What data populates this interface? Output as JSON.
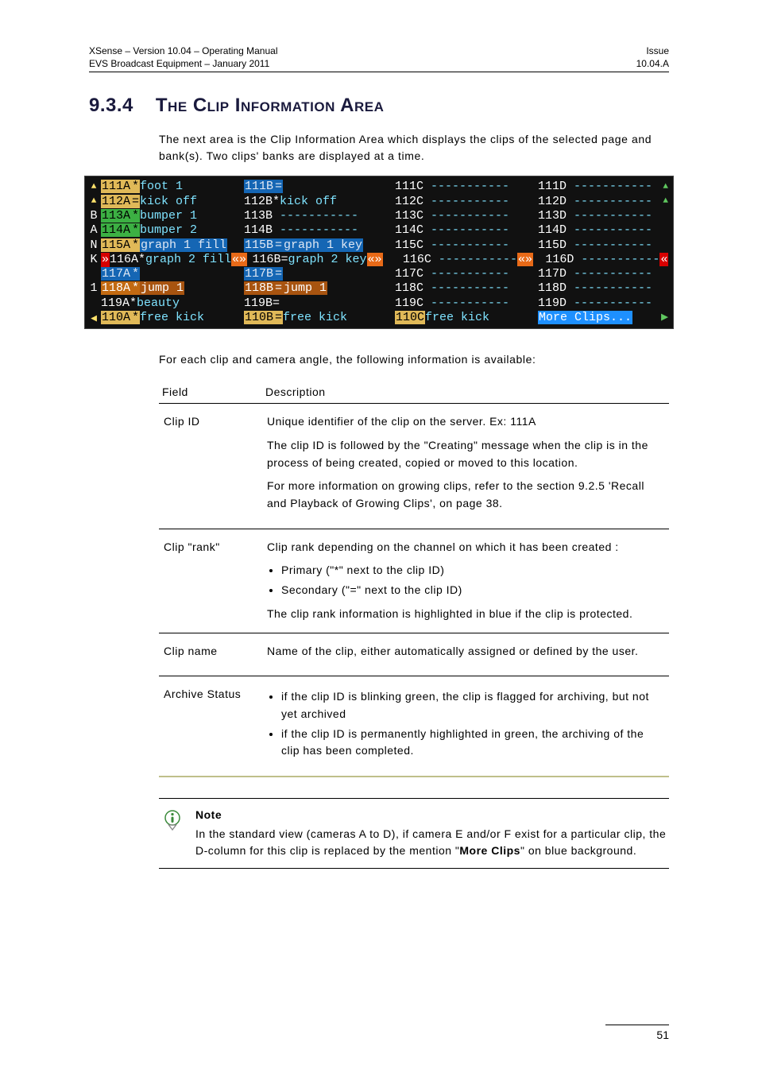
{
  "header": {
    "left_line1": "XSense – Version 10.04 – Operating Manual",
    "left_line2": "EVS Broadcast Equipment  – January 2011",
    "right_line1": "Issue",
    "right_line2": "10.04.A"
  },
  "section": {
    "number": "9.3.4",
    "title": "The Clip Information Area"
  },
  "intro1": "The next area is the Clip Information Area which displays the clips of the selected page and bank(s). Two clips' banks are displayed at a time.",
  "intro2": "For each clip and camera angle, the following information is available:",
  "terminal": {
    "rows": [
      {
        "gutter": {
          "glyph": "▲",
          "cls": "g-yellow glyph-up"
        },
        "A": {
          "id": "111A",
          "rank": "*",
          "name": "foot 1",
          "id_hl": "hl-yellow"
        },
        "B": {
          "id": "111B",
          "rank": "=",
          "name": " ",
          "id_hl": "hl-blue-dk"
        },
        "C": {
          "id": "111C",
          "dashes": true
        },
        "D": {
          "id": "111D",
          "dashes": true
        },
        "end": {
          "glyph": "▲",
          "cls": "nav-tri glyph-up"
        }
      },
      {
        "gutter": {
          "glyph": "▲",
          "cls": "g-yellow glyph-up"
        },
        "A": {
          "id": "112A",
          "rank": "=",
          "name": "kick off",
          "id_hl": "hl-yellow"
        },
        "B": {
          "id": "112B",
          "rank": "*",
          "name": "kick off",
          "name_cls": "name",
          "id_hl": ""
        },
        "C": {
          "id": "112C",
          "dashes": true
        },
        "D": {
          "id": "112D",
          "dashes": true
        },
        "end": {
          "glyph": "▲",
          "cls": "nav-tri glyph-up"
        }
      },
      {
        "gutter": {
          "text": "B",
          "cls": "g-white"
        },
        "A": {
          "id": "113A",
          "rank": "*",
          "name": "bumper 1",
          "id_hl": "hl-green"
        },
        "B": {
          "id": "113B",
          "dashes": true
        },
        "C": {
          "id": "113C",
          "dashes": true
        },
        "D": {
          "id": "113D",
          "dashes": true
        }
      },
      {
        "gutter": {
          "text": "A",
          "cls": "g-white"
        },
        "A": {
          "id": "114A",
          "rank": "*",
          "name": "bumper 2",
          "id_hl": "hl-green"
        },
        "B": {
          "id": "114B",
          "dashes": true
        },
        "C": {
          "id": "114C",
          "dashes": true
        },
        "D": {
          "id": "114D",
          "dashes": true
        }
      },
      {
        "gutter": {
          "text": "N",
          "cls": "g-white"
        },
        "A": {
          "id": "115A",
          "rank": "*",
          "name": "graph 1 fill",
          "id_hl": "hl-yellow",
          "name_hl": "hl-blue-dk"
        },
        "B": {
          "id": "115B",
          "rank": "=",
          "name": "graph 1 key",
          "id_hl": "hl-blue-dk",
          "name_hl": "hl-blue-dk"
        },
        "C": {
          "id": "115C",
          "dashes": true
        },
        "D": {
          "id": "115D",
          "dashes": true
        }
      },
      {
        "gutter": {
          "text": "K",
          "cls": "g-white"
        },
        "pre_gutter_ico": {
          "hl": "hl-red",
          "glyph": "»"
        },
        "A": {
          "id": "116A",
          "rank": "*",
          "name": "graph 2 fill",
          "id_hl": "",
          "name_cls": "name",
          "post_ico": {
            "hl": "hl-orange-ico",
            "glyph": "«»"
          }
        },
        "B": {
          "id": "116B",
          "rank": "=",
          "name": "graph 2 key",
          "post_ico": {
            "hl": "hl-orange-ico",
            "glyph": "«»"
          }
        },
        "C": {
          "id": "116C",
          "dashes": true,
          "id_hl": "",
          "post_ico": {
            "hl": "hl-orange-ico",
            "glyph": "«»"
          }
        },
        "D": {
          "id": "116D",
          "dashes": true,
          "post_ico": {
            "hl": "hl-red",
            "glyph": "«"
          }
        }
      },
      {
        "gutter": {
          "text": " "
        },
        "A": {
          "id": "117A",
          "rank": "*",
          "name": " ",
          "id_hl": "hl-blue-dk"
        },
        "B": {
          "id": "117B",
          "rank": "=",
          "name": " ",
          "id_hl": "hl-blue-dk"
        },
        "C": {
          "id": "117C",
          "dashes": true
        },
        "D": {
          "id": "117D",
          "dashes": true
        }
      },
      {
        "gutter": {
          "text": "1",
          "cls": "g-white"
        },
        "A": {
          "id": "118A",
          "rank": "*",
          "name": "jump 1",
          "id_hl": "hl-orange",
          "name_hl": "hl-dk-orange",
          "full_row_hl": true
        },
        "B": {
          "id": "118B",
          "rank": "=",
          "name": "jump 1",
          "id_hl": "hl-dk-orange",
          "name_hl": "hl-dk-orange"
        },
        "C": {
          "id": "118C",
          "dashes": true
        },
        "D": {
          "id": "118D",
          "dashes": true
        }
      },
      {
        "gutter": {
          "text": " "
        },
        "A": {
          "id": "119A",
          "rank": "*",
          "name": "beauty",
          "id_hl": ""
        },
        "B": {
          "id": "119B",
          "rank": "=",
          "name": " ",
          "id_hl": ""
        },
        "C": {
          "id": "119C",
          "dashes": true
        },
        "D": {
          "id": "119D",
          "dashes": true
        }
      },
      {
        "gutter": {
          "glyph": "◀",
          "cls": "g-yellow glyph-left"
        },
        "A": {
          "id": "110A",
          "rank": "*",
          "name": "free kick",
          "id_hl": "hl-yellow"
        },
        "B": {
          "id": "110B",
          "rank": "=",
          "name": "free kick",
          "id_hl": "hl-yellow"
        },
        "C": {
          "id": "110C",
          "name": "free kick",
          "id_hl": "hl-yellow",
          "free": " "
        },
        "D": {
          "more": "More Clips...",
          "more_hl": "hl-blue-bri"
        },
        "end": {
          "glyph": "▶",
          "cls": "nav-tri"
        }
      }
    ],
    "dash_text": " -----------"
  },
  "table": {
    "head_field": "Field",
    "head_desc": "Description",
    "rows": [
      {
        "field": "Clip ID",
        "desc_paras": [
          "Unique identifier of the clip on the server. Ex: 111A",
          "The clip ID is followed by the \"Creating\" message when the clip is in the process of being created, copied or moved to this location.",
          "For more information on growing clips, refer to the section 9.2.5 'Recall and Playback of Growing Clips', on page 38."
        ]
      },
      {
        "field": "Clip \"rank\"",
        "desc_paras": [
          "Clip rank depending on the channel on which it has been created :"
        ],
        "bullets": [
          "Primary (\"*\" next to the clip ID)",
          "Secondary (\"=\" next to the clip ID)"
        ],
        "desc_after": [
          "The clip rank information is highlighted in blue if the clip is protected."
        ]
      },
      {
        "field": "Clip name",
        "desc_paras": [
          "Name of the clip, either automatically assigned or defined by the user."
        ]
      },
      {
        "field": "Archive Status",
        "bullets": [
          "if the clip ID is blinking green, the clip is flagged for archiving, but not yet archived",
          "if the clip ID is permanently highlighted in green, the archiving of the clip has been completed."
        ]
      }
    ]
  },
  "note": {
    "lead": "Note",
    "body_pre": "In the standard view (cameras A to D), if camera E and/or F exist for a particular clip, the D-column for this clip is replaced by the mention \"",
    "body_bold": "More Clips",
    "body_post": "\" on blue background."
  },
  "page_number": "51"
}
